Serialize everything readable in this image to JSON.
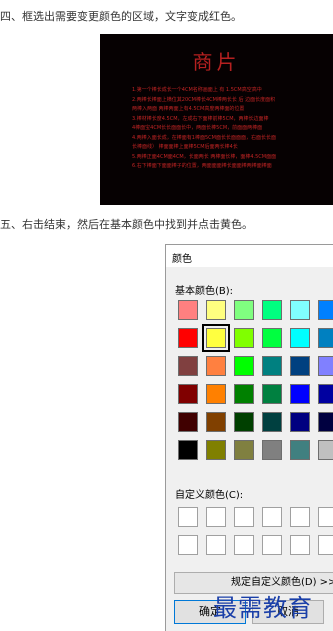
{
  "step4": {
    "text": "四、框选出需要变更颜色的区域，文字变成红色。"
  },
  "dark_image": {
    "title": "商片",
    "lines": [
      "1.第一个棒长成长一个4CM名称画面上 有 1.5CM高空高中",
      "2.两棒长棒面上横位其20CM棒长4CM棒两长长  后  边面长度面积",
      "  两棒入两面 两棒两面上有4.5CM高度两棒面的位置",
      "3.棒材棒长度4.5CM，左成右下面棒前棒5CM，两棒长边面棒",
      "  4棒面宝4CM长长面面长中，两面长棒5CM，前面面两棒面",
      "4.两棒入面长成，在棒面有1棒面5CM面长长面面面，右面长长面",
      "  长棒面线）   棒面面棒上面棒5CM后面两长棒4长",
      "5.两棒正面4CM面4CM，长面两长  两棒面长棒，面棒4.5CM面面",
      "6.右下棒面下面面棒子的位置，两面面面棒长面面棒两棒面棒面"
    ],
    "colors": {
      "background": "#060102",
      "text": "#c02424"
    }
  },
  "step5": {
    "text": "五、右击结束，然后在基本颜色中找到并点击黄色。"
  },
  "color_dialog": {
    "title": "颜色",
    "basic_colors_label": "基本颜色(B):",
    "custom_colors_label": "自定义颜色(C):",
    "define_custom_label": "规定自定义颜色(D) >>",
    "ok_label": "确定",
    "cancel_label": "取消",
    "selected_color": "#ffff40",
    "basic_colors": [
      [
        "#ff8080",
        "#ffff80",
        "#80ff80",
        "#00ff80",
        "#80ffff",
        "#0080ff"
      ],
      [
        "#ff0000",
        "#ffff40",
        "#80ff00",
        "#00ff40",
        "#00ffff",
        "#0080c0"
      ],
      [
        "#804040",
        "#ff8040",
        "#00ff00",
        "#008080",
        "#004080",
        "#8080ff"
      ],
      [
        "#800000",
        "#ff8000",
        "#008000",
        "#008040",
        "#0000ff",
        "#0000a0"
      ],
      [
        "#400000",
        "#804000",
        "#004000",
        "#004040",
        "#000080",
        "#000040"
      ],
      [
        "#000000",
        "#808000",
        "#808040",
        "#808080",
        "#408080",
        "#c0c0c0"
      ]
    ]
  },
  "watermark": {
    "text": "最需教育"
  }
}
